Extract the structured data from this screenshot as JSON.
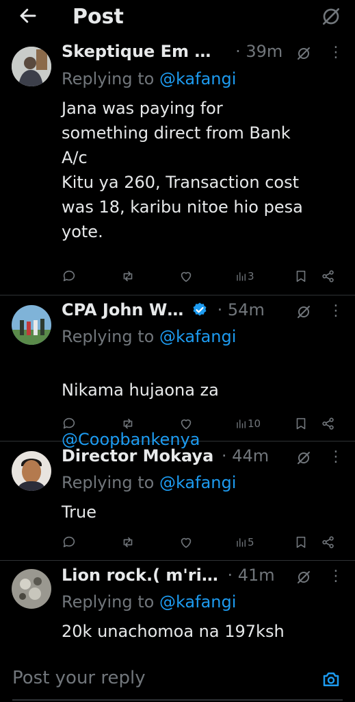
{
  "header": {
    "title": "Post"
  },
  "replies": [
    {
      "name": "Skeptique Em …",
      "time": "· 39m",
      "replying_prefix": "Replying to ",
      "handle": "@kafangi",
      "text": "Jana was paying for\nsomething direct from Bank\nA/c\nKitu ya 260, Transaction cost\nwas 18, karibu nitoe hio pesa\nyote.",
      "views": "3"
    },
    {
      "name": "CPA John W…",
      "verified": true,
      "time": "· 54m",
      "replying_prefix": "Replying to ",
      "handle": "@kafangi",
      "text": "Nikama hujaona za",
      "mention": "@Coopbankenya",
      "views": "10"
    },
    {
      "name": "Director Mokaya",
      "time": "· 44m",
      "replying_prefix": "Replying to ",
      "handle": "@kafangi",
      "text": "True",
      "views": "5"
    },
    {
      "name": "Lion rock.( m'ri…",
      "time": "· 41m",
      "replying_prefix": "Replying to ",
      "handle": "@kafangi",
      "text": "20k unachomoa na 197ksh"
    }
  ],
  "compose": {
    "placeholder": "Post your reply"
  },
  "colors": {
    "accent": "#1d9bf0",
    "muted": "#71767b",
    "text": "#e7e9ea",
    "background": "#000000"
  }
}
